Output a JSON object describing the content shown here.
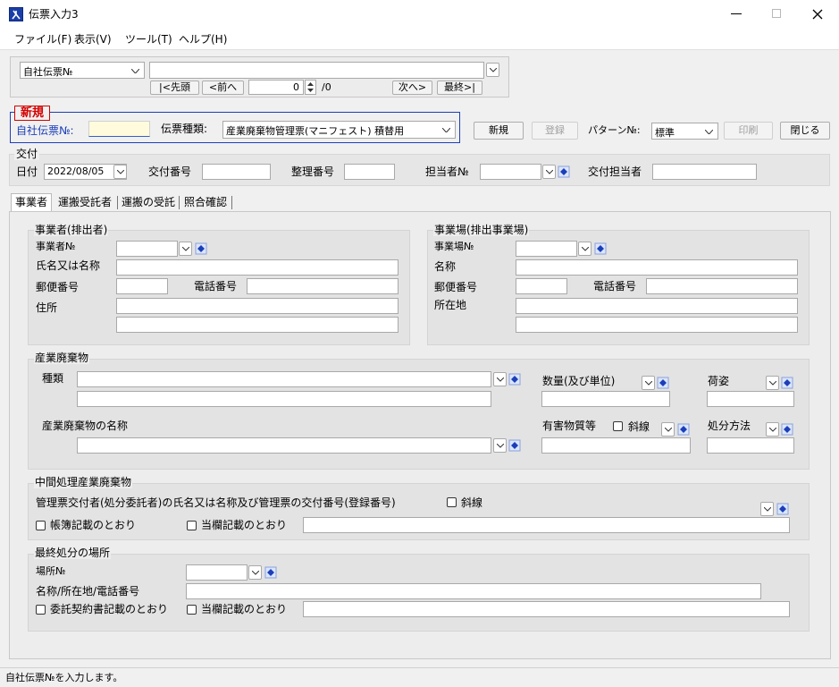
{
  "window": {
    "title": "伝票入力3",
    "status": "自社伝票№を入力します。"
  },
  "menu": [
    "ファイル(F)",
    "表示(V)",
    "ツール(T)",
    "ヘルプ(H)"
  ],
  "nav": {
    "search_type": "自社伝票№",
    "search_value": "",
    "first": "|<先頭",
    "prev": "<前へ",
    "page": "0",
    "total": "/0",
    "next": "次へ>",
    "last": "最終>|"
  },
  "header": {
    "mode_badge": "新規",
    "slip_label": "自社伝票№:",
    "slip_value": "",
    "kind_label": "伝票種類:",
    "kind_value": "産業廃棄物管理票(マニフェスト) 積替用",
    "new_btn": "新規",
    "register_btn": "登録",
    "pattern_label": "パターン№:",
    "pattern_value": "標準",
    "print_btn": "印刷",
    "close_btn": "閉じる"
  },
  "issue": {
    "legend": "交付",
    "date_label": "日付",
    "date_value": "2022/08/05",
    "issue_no_label": "交付番号",
    "ref_no_label": "整理番号",
    "staff_no_label": "担当者№",
    "issuer_label": "交付担当者"
  },
  "tabs": [
    "事業者",
    "運搬受託者",
    "運搬の受託",
    "照合確認"
  ],
  "operator": {
    "legend": "事業者(排出者)",
    "no_label": "事業者№",
    "name_label": "氏名又は名称",
    "zip_label": "郵便番号",
    "tel_label": "電話番号",
    "addr_label": "住所"
  },
  "site": {
    "legend": "事業場(排出事業場)",
    "no_label": "事業場№",
    "name_label": "名称",
    "zip_label": "郵便番号",
    "tel_label": "電話番号",
    "addr_label": "所在地"
  },
  "waste": {
    "legend": "産業廃棄物",
    "kind_label": "種類",
    "qty_label": "数量(及び単位)",
    "pack_label": "荷姿",
    "name_label": "産業廃棄物の名称",
    "hazard_label": "有害物質等",
    "strike_label": "斜線",
    "disposal_label": "処分方法"
  },
  "intermediate": {
    "legend": "中間処理産業廃棄物",
    "desc": "管理票交付者(処分委託者)の氏名又は名称及び管理票の交付番号(登録番号)",
    "strike_label": "斜線",
    "ledger_label": "帳簿記載のとおり",
    "field_label": "当欄記載のとおり"
  },
  "final": {
    "legend": "最終処分の場所",
    "place_no_label": "場所№",
    "name_label": "名称/所在地/電話番号",
    "contract_label": "委託契約書記載のとおり",
    "field_label": "当欄記載のとおり"
  },
  "colors": {
    "accent_blue": "#1c3fb8",
    "badge_red": "#d40000",
    "selected_input": "#fffbdc"
  }
}
